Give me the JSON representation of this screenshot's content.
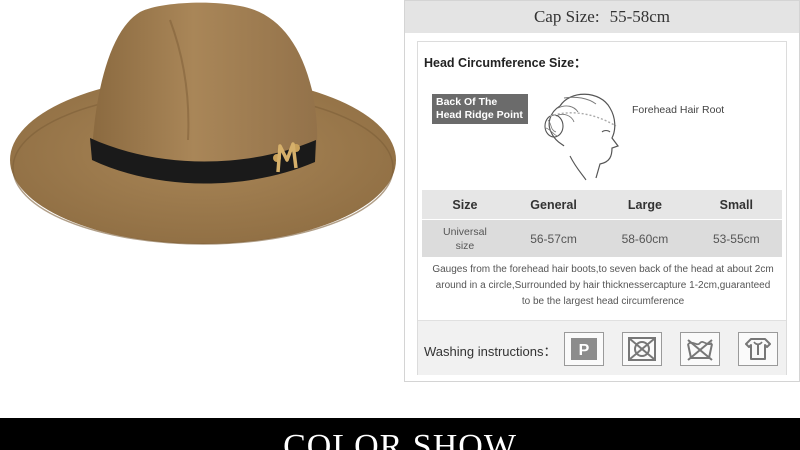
{
  "cap": {
    "label": "Cap Size:",
    "value": "55-58cm"
  },
  "head": {
    "title": "Head Circumference Size：",
    "back_label_line1": "Back Of The",
    "back_label_line2": "Head Ridge Point",
    "forehead_label": "Forehead Hair Root"
  },
  "table": {
    "headers": [
      "Size",
      "General",
      "Large",
      "Small"
    ],
    "row_label_line1": "Universal",
    "row_label_line2": "size",
    "values": [
      "56-57cm",
      "58-60cm",
      "53-55cm"
    ]
  },
  "note_lines": [
    "Gauges from the forehead hair boots,to seven back of the head at about 2cm",
    "around in a circle,Surrounded by hair thicknessercapture 1-2cm,guaranteed",
    "to be the largest head circumference"
  ],
  "washing": {
    "label": "Washing instructions：",
    "icons": [
      "dry-clean-p-icon",
      "no-tumble-dry-icon",
      "no-wash-icon",
      "hang-dry-icon"
    ],
    "p_letter": "P"
  },
  "footer": {
    "title": "COLOR SHOW"
  },
  "colors": {
    "hat_felt": "#a07c4f",
    "band": "#1a1a1a",
    "buckle": "#c9a15a"
  }
}
